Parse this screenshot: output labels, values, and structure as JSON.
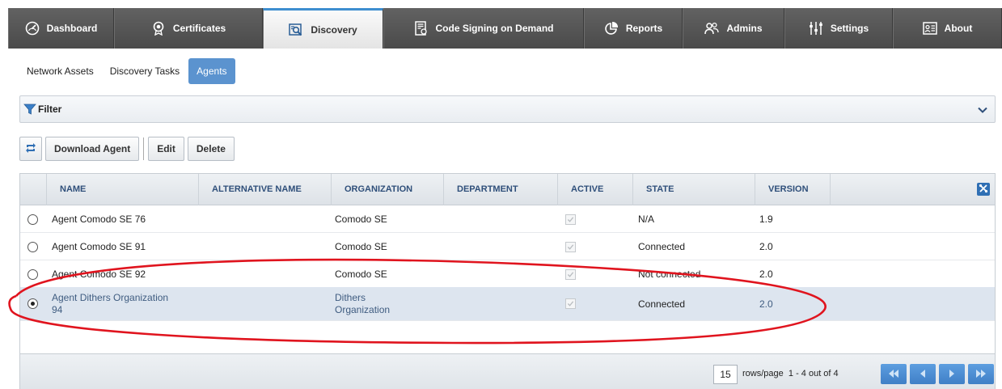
{
  "nav": {
    "tabs": [
      {
        "label": "Dashboard",
        "icon": "dashboard-gauge-icon"
      },
      {
        "label": "Certificates",
        "icon": "certificate-badge-icon"
      },
      {
        "label": "Discovery",
        "icon": "discovery-search-icon",
        "active": true
      },
      {
        "label": "Code Signing on Demand",
        "icon": "code-signing-icon"
      },
      {
        "label": "Reports",
        "icon": "reports-chart-icon"
      },
      {
        "label": "Admins",
        "icon": "admins-users-icon"
      },
      {
        "label": "Settings",
        "icon": "settings-sliders-icon"
      },
      {
        "label": "About",
        "icon": "about-card-icon"
      }
    ]
  },
  "subtabs": {
    "network_assets": "Network Assets",
    "discovery_tasks": "Discovery Tasks",
    "agents": "Agents"
  },
  "filter": {
    "label": "Filter"
  },
  "toolbar": {
    "refresh_icon": "refresh-icon",
    "download_agent": "Download Agent",
    "edit": "Edit",
    "delete": "Delete"
  },
  "table": {
    "headers": {
      "name": "NAME",
      "alt_name": "ALTERNATIVE NAME",
      "organization": "ORGANIZATION",
      "department": "DEPARTMENT",
      "active": "ACTIVE",
      "state": "STATE",
      "version": "VERSION"
    },
    "rows": [
      {
        "name": "Agent Comodo SE 76",
        "alt_name": "",
        "organization": "Comodo SE",
        "department": "",
        "active": true,
        "state": "N/A",
        "version": "1.9",
        "selected": false
      },
      {
        "name": "Agent Comodo SE 91",
        "alt_name": "",
        "organization": "Comodo SE",
        "department": "",
        "active": true,
        "state": "Connected",
        "version": "2.0",
        "selected": false
      },
      {
        "name": "Agent Comodo SE 92",
        "alt_name": "",
        "organization": "Comodo SE",
        "department": "",
        "active": true,
        "state": "Not connected",
        "version": "2.0",
        "selected": false
      },
      {
        "name_line1": "Agent Dithers Organization",
        "name_line2": "94",
        "alt_name": "",
        "org_line1": "Dithers",
        "org_line2": "Organization",
        "department": "",
        "active": true,
        "state": "Connected",
        "version": "2.0",
        "selected": true
      }
    ]
  },
  "pager": {
    "rows_per_page": "15",
    "rows_label": "rows/page",
    "range": "1 - 4 out of 4"
  },
  "colors": {
    "nav_bg": "#555555",
    "accent": "#3e8ed0",
    "subtab_active": "#5b93cf",
    "annotation": "#e0141e"
  }
}
